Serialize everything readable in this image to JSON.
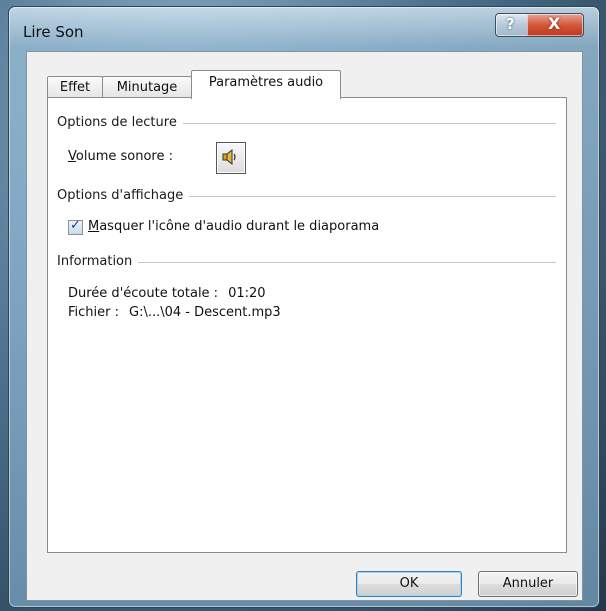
{
  "window": {
    "title": "Lire Son",
    "help_label": "?",
    "close_label": "X"
  },
  "tabs": {
    "effet": "Effet",
    "minutage": "Minutage",
    "parametres_audio": "Paramètres audio"
  },
  "playback_options": {
    "header": "Options de lecture",
    "volume_label_accel": "V",
    "volume_label_rest": "olume sonore :",
    "volume_icon": "speaker-icon"
  },
  "display_options": {
    "header": "Options d'affichage",
    "hide_icon_label_accel": "M",
    "hide_icon_label_rest": "asquer l'icône d'audio durant le diaporama",
    "hide_icon_checked": true
  },
  "information": {
    "header": "Information",
    "duration_label": "Durée d'écoute totale :",
    "duration_value": "01:20",
    "file_label": "Fichier :",
    "file_value": "G:\\...\\04 - Descent.mp3"
  },
  "buttons": {
    "ok": "OK",
    "cancel": "Annuler"
  }
}
